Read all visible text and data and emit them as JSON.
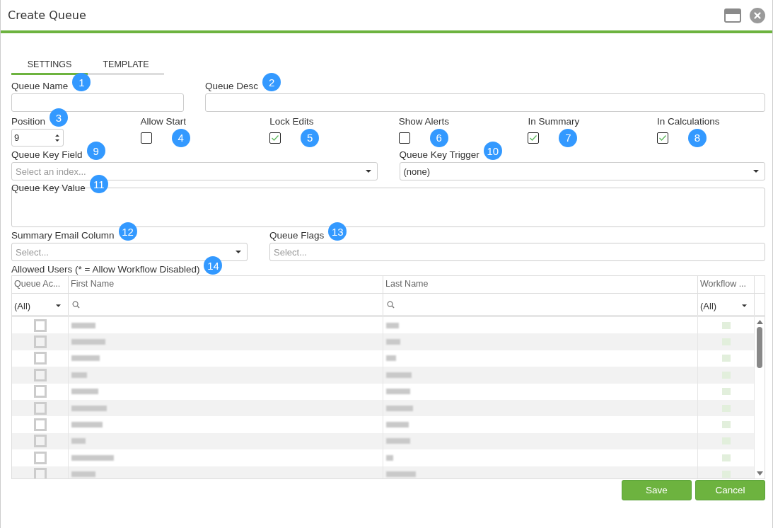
{
  "window": {
    "title": "Create Queue"
  },
  "tabs": [
    {
      "label": "SETTINGS",
      "selected": true
    },
    {
      "label": "TEMPLATE",
      "selected": false
    }
  ],
  "form_rows": [
    [
      {
        "kind": "text",
        "label": "Queue Name",
        "callout": "1"
      },
      {
        "kind": "text",
        "label": "Queue Desc",
        "callout": "2"
      }
    ],
    [
      {
        "kind": "number",
        "label": "Position",
        "callout": "3",
        "value": "9"
      },
      {
        "kind": "checkbox",
        "label": "Allow Start",
        "callout": "4",
        "checked": false
      },
      {
        "kind": "checkbox",
        "label": "Lock Edits",
        "callout": "5",
        "checked": true
      },
      {
        "kind": "checkbox",
        "label": "Show Alerts",
        "callout": "6",
        "checked": false
      },
      {
        "kind": "checkbox",
        "label": "In Summary",
        "callout": "7",
        "checked": true
      },
      {
        "kind": "checkbox",
        "label": "In Calculations",
        "callout": "8",
        "checked": true
      }
    ],
    [
      {
        "kind": "select",
        "label": "Queue Key Field",
        "callout": "9",
        "placeholder": "Select an index..."
      },
      {
        "kind": "select",
        "label": "Queue Key Trigger",
        "callout": "10",
        "value": "(none)"
      }
    ],
    [
      {
        "kind": "textarea",
        "label": "Queue Key Value",
        "callout": "11"
      }
    ],
    [
      {
        "kind": "select",
        "label": "Summary Email Column",
        "callout": "12",
        "placeholder": "Select..."
      },
      {
        "kind": "multiselect",
        "label": "Queue Flags",
        "callout": "13",
        "placeholder": "Select..."
      }
    ]
  ],
  "users_grid": {
    "label": "Allowed Users (* = Allow Workflow Disabled)",
    "callout": "14",
    "columns": [
      {
        "label": "Queue Ac...",
        "kind": "dropdown",
        "filter_value": "(All)"
      },
      {
        "label": "First Name",
        "kind": "search"
      },
      {
        "label": "Last Name",
        "kind": "search"
      },
      {
        "label": "Workflow ...",
        "kind": "dropdown",
        "filter_value": "(All)"
      }
    ],
    "rows": [
      {
        "checked": false
      },
      {
        "checked": false
      },
      {
        "checked": false
      },
      {
        "checked": false
      },
      {
        "checked": false
      },
      {
        "checked": false
      },
      {
        "checked": false
      },
      {
        "checked": false
      },
      {
        "checked": false
      },
      {
        "checked": false
      }
    ]
  },
  "buttons": [
    "Save",
    "Cancel"
  ]
}
